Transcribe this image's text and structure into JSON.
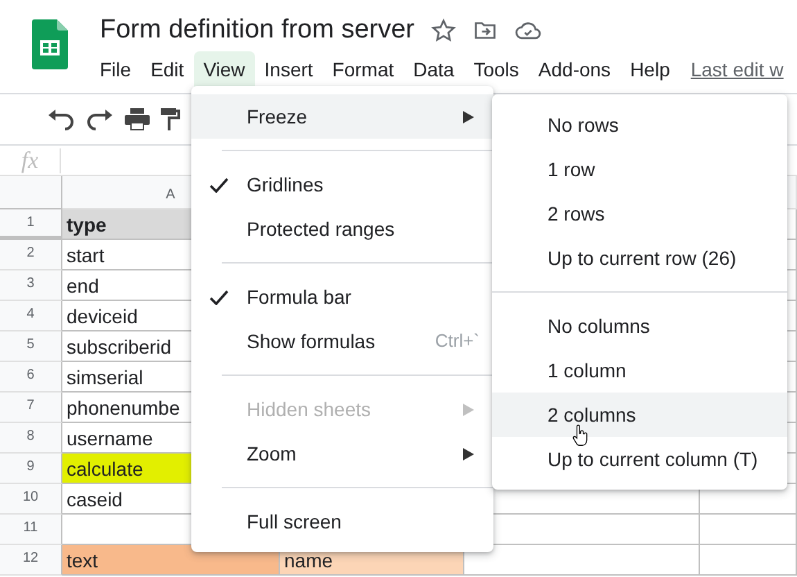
{
  "document": {
    "title": "Form definition from server",
    "starred": false
  },
  "menubar": [
    {
      "label": "File",
      "selected": false
    },
    {
      "label": "Edit",
      "selected": false
    },
    {
      "label": "View",
      "selected": true
    },
    {
      "label": "Insert",
      "selected": false
    },
    {
      "label": "Format",
      "selected": false
    },
    {
      "label": "Data",
      "selected": false
    },
    {
      "label": "Tools",
      "selected": false
    },
    {
      "label": "Add-ons",
      "selected": false
    },
    {
      "label": "Help",
      "selected": false
    }
  ],
  "last_edit": "Last edit w",
  "formula_bar": {
    "label": "fx"
  },
  "sheet": {
    "column_header": "A",
    "rows": [
      {
        "number": "1",
        "kind": "header",
        "cells": [
          {
            "text": "type",
            "color": "#d9d9d9"
          }
        ]
      },
      {
        "number": "2",
        "kind": "data",
        "cells": [
          {
            "text": "start"
          }
        ]
      },
      {
        "number": "3",
        "kind": "data",
        "cells": [
          {
            "text": "end"
          }
        ]
      },
      {
        "number": "4",
        "kind": "data",
        "cells": [
          {
            "text": "deviceid"
          }
        ]
      },
      {
        "number": "5",
        "kind": "data",
        "cells": [
          {
            "text": "subscriberid"
          }
        ]
      },
      {
        "number": "6",
        "kind": "data",
        "cells": [
          {
            "text": "simserial"
          }
        ]
      },
      {
        "number": "7",
        "kind": "data",
        "cells": [
          {
            "text": "phonenumbe"
          }
        ]
      },
      {
        "number": "8",
        "kind": "data",
        "cells": [
          {
            "text": "username"
          }
        ]
      },
      {
        "number": "9",
        "kind": "data",
        "cells": [
          {
            "text": "calculate",
            "color": "#e2ef00"
          }
        ]
      },
      {
        "number": "10",
        "kind": "data",
        "cells": [
          {
            "text": "caseid"
          }
        ]
      },
      {
        "number": "11",
        "kind": "data",
        "cells": []
      },
      {
        "number": "12",
        "kind": "data",
        "cells": [
          {
            "text": "text",
            "color": "#f8b98b"
          },
          {
            "text": "name",
            "color": "#fcd5b6"
          }
        ]
      }
    ]
  },
  "view_menu": {
    "items": [
      {
        "kind": "item",
        "label": "Freeze",
        "selected": true,
        "checked": false,
        "disabled": false,
        "has_submenu": true
      },
      {
        "kind": "divider"
      },
      {
        "kind": "item",
        "label": "Gridlines",
        "selected": false,
        "checked": true,
        "disabled": false,
        "has_submenu": false
      },
      {
        "kind": "item",
        "label": "Protected ranges",
        "selected": false,
        "checked": false,
        "disabled": false,
        "has_submenu": false
      },
      {
        "kind": "divider"
      },
      {
        "kind": "item",
        "label": "Formula bar",
        "selected": false,
        "checked": true,
        "disabled": false,
        "has_submenu": false
      },
      {
        "kind": "item",
        "label": "Show formulas",
        "selected": false,
        "checked": false,
        "disabled": false,
        "has_submenu": false,
        "shortcut": "Ctrl+`"
      },
      {
        "kind": "divider"
      },
      {
        "kind": "item",
        "label": "Hidden sheets",
        "selected": false,
        "checked": false,
        "disabled": true,
        "has_submenu": true
      },
      {
        "kind": "item",
        "label": "Zoom",
        "selected": false,
        "checked": false,
        "disabled": false,
        "has_submenu": true
      },
      {
        "kind": "divider"
      },
      {
        "kind": "item",
        "label": "Full screen",
        "selected": false,
        "checked": false,
        "disabled": false,
        "has_submenu": false
      }
    ]
  },
  "freeze_menu": {
    "items": [
      {
        "kind": "item",
        "label": "No rows",
        "selected": false
      },
      {
        "kind": "item",
        "label": "1 row",
        "selected": false
      },
      {
        "kind": "item",
        "label": "2 rows",
        "selected": false
      },
      {
        "kind": "item",
        "label": "Up to current row (26)",
        "selected": false
      },
      {
        "kind": "divider"
      },
      {
        "kind": "item",
        "label": "No columns",
        "selected": false
      },
      {
        "kind": "item",
        "label": "1 column",
        "selected": false
      },
      {
        "kind": "item",
        "label": "2 columns",
        "selected": true
      },
      {
        "kind": "item",
        "label": "Up to current column (T)",
        "selected": false
      }
    ]
  }
}
